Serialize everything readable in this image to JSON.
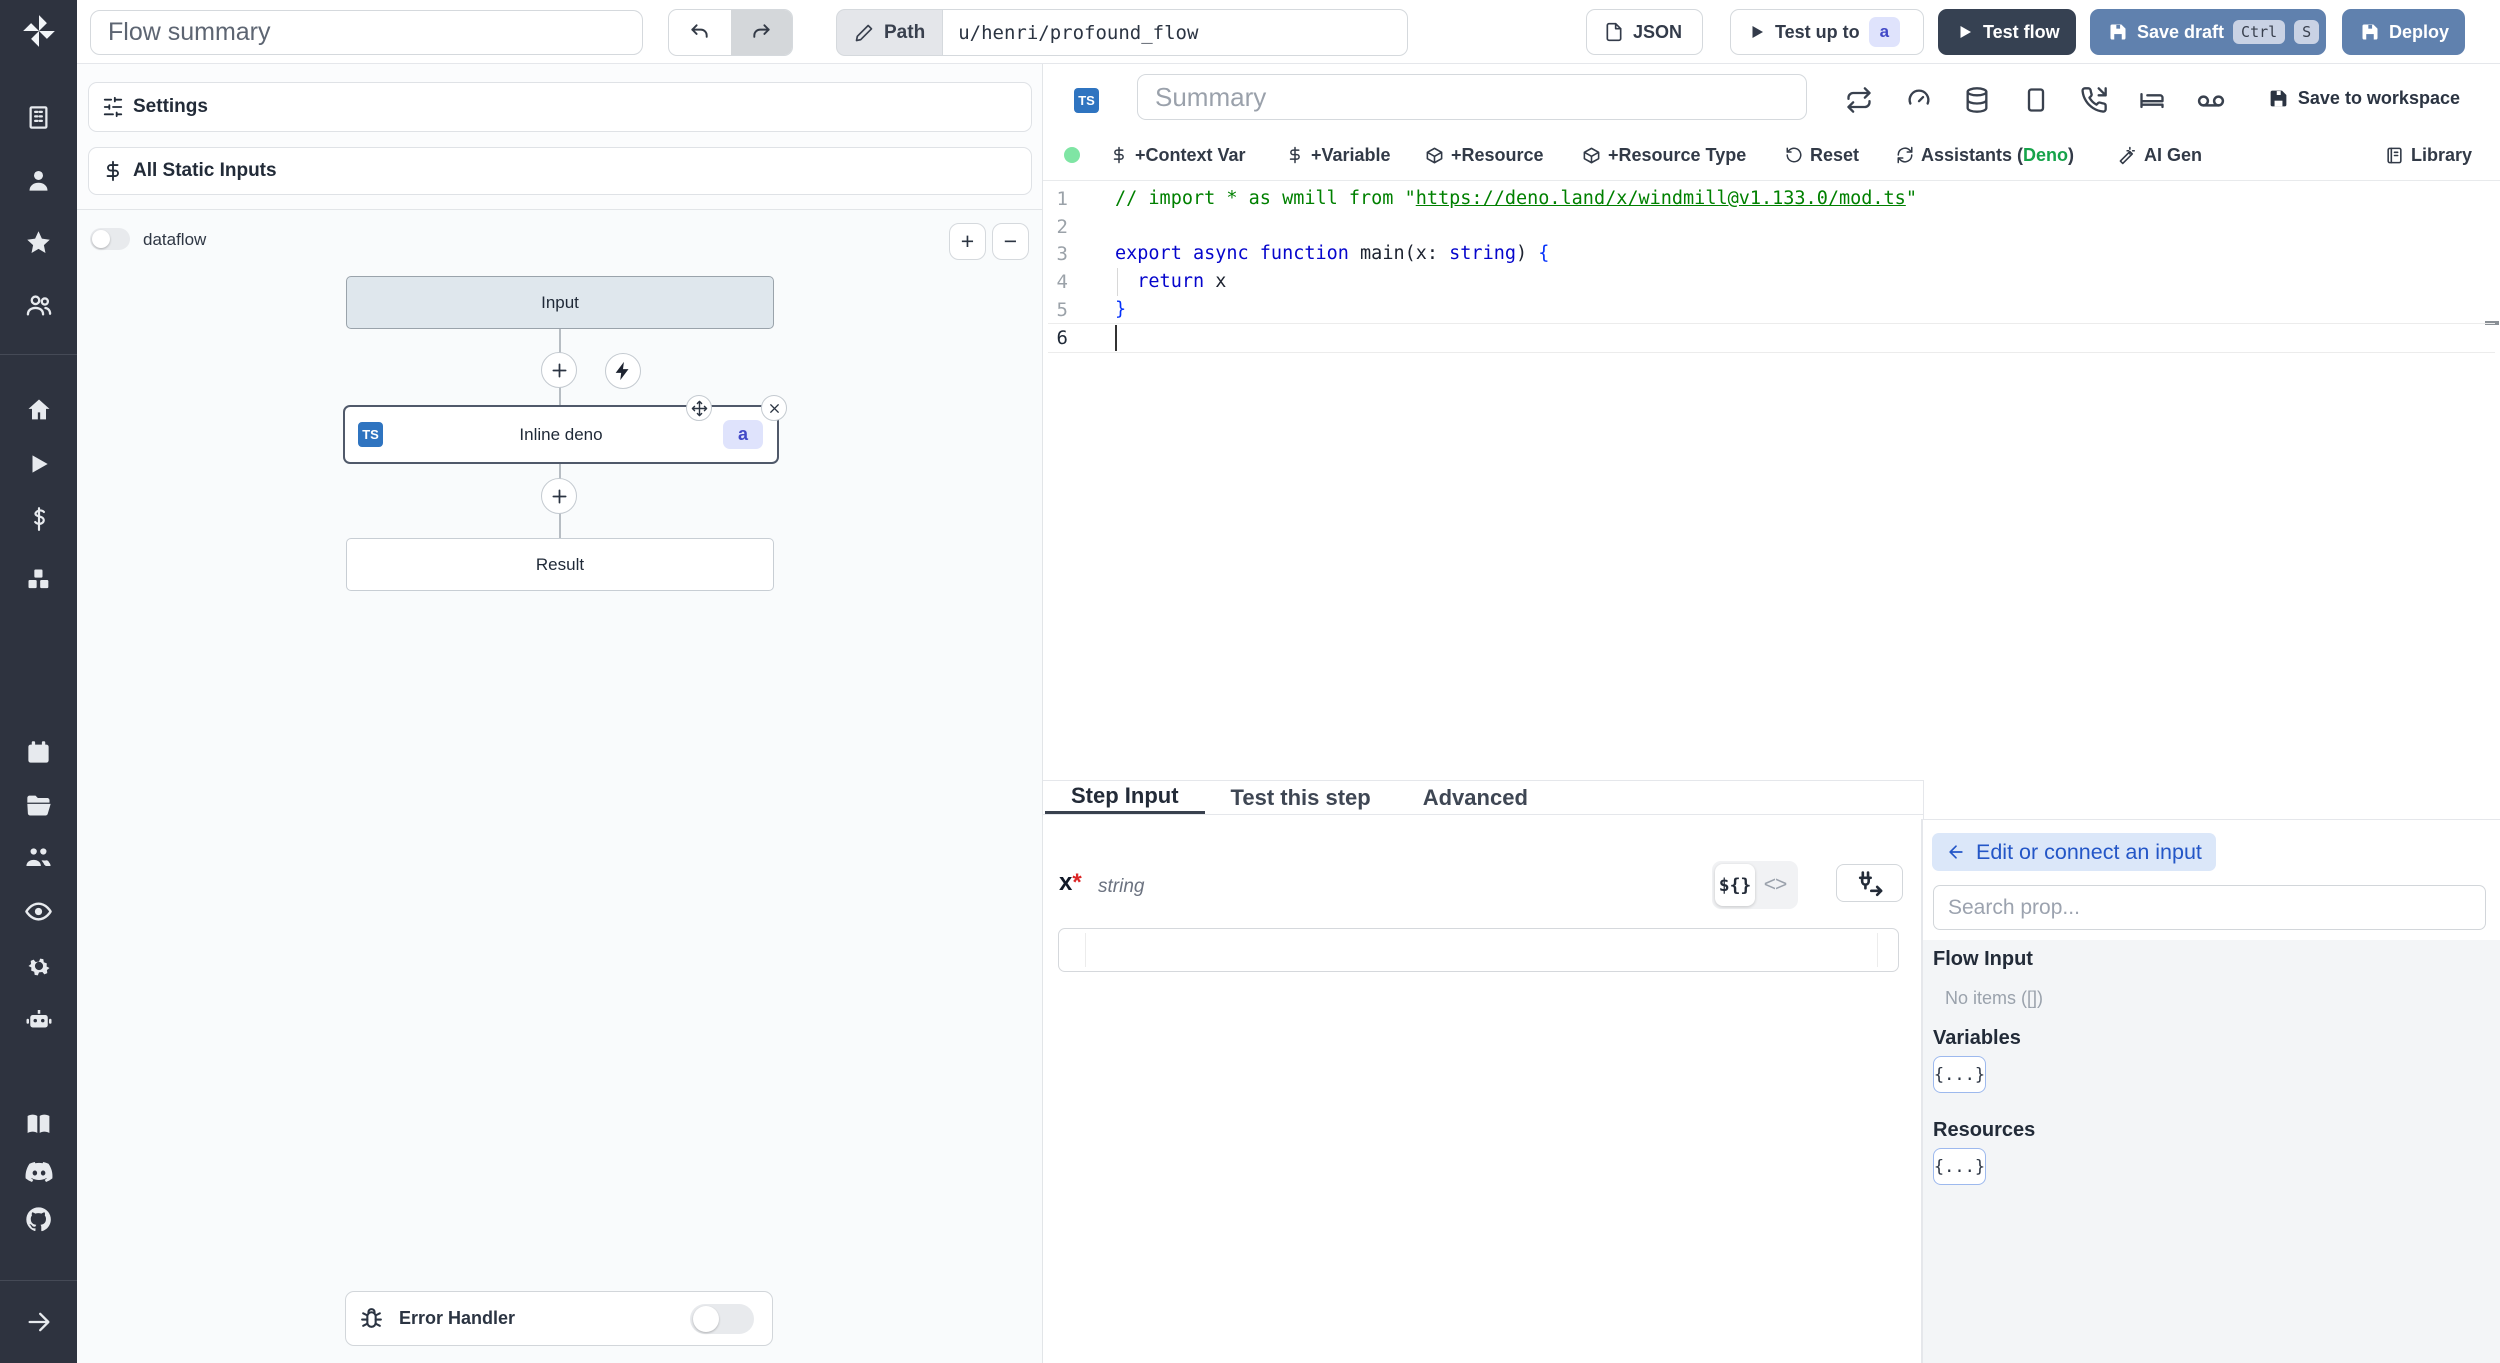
{
  "topbar": {
    "flow_summary": "Flow summary",
    "path_label": "Path",
    "path_value": "u/henri/profound_flow",
    "json_label": "JSON",
    "test_up_to_label": "Test up to",
    "test_up_to_badge": "a",
    "test_flow_label": "Test flow",
    "save_draft_label": "Save draft",
    "kbd_ctrl": "Ctrl",
    "kbd_s": "S",
    "deploy_label": "Deploy"
  },
  "left_panel": {
    "settings_label": "Settings",
    "static_inputs_label": "All Static Inputs",
    "dataflow_label": "dataflow",
    "zoom_in": "+",
    "zoom_out": "−",
    "error_handler_label": "Error Handler"
  },
  "flow": {
    "input_node": "Input",
    "step_node": "Inline deno",
    "step_lang_badge": "TS",
    "step_badge": "a",
    "result_node": "Result"
  },
  "editor": {
    "lang_badge": "TS",
    "summary_placeholder": "Summary",
    "save_to_workspace": "Save to workspace",
    "toolbar": {
      "context_var": "+Context Var",
      "variable": "+Variable",
      "resource": "+Resource",
      "resource_type": "+Resource Type",
      "reset": "Reset",
      "assistants_prefix": "Assistants (",
      "assistants_lang": "Deno",
      "assistants_suffix": ")",
      "ai_gen": "AI Gen",
      "library": "Library"
    }
  },
  "code": {
    "lines": [
      {
        "num": "1",
        "segments": [
          [
            "c",
            "// import * as wmill from \""
          ],
          [
            "u",
            "https://deno.land/x/windmill@v1.133.0/mod.ts"
          ],
          [
            "c",
            "\""
          ]
        ]
      },
      {
        "num": "2",
        "segments": []
      },
      {
        "num": "3",
        "segments": [
          [
            "k",
            "export async function "
          ],
          [
            "p",
            "main(x: "
          ],
          [
            "k",
            "string"
          ],
          [
            "p",
            ") "
          ],
          [
            "b",
            "{"
          ]
        ]
      },
      {
        "num": "4",
        "segments": [
          [
            "p",
            "  "
          ],
          [
            "k",
            "return"
          ],
          [
            "p",
            " x"
          ]
        ]
      },
      {
        "num": "5",
        "segments": [
          [
            "b",
            "}"
          ]
        ]
      },
      {
        "num": "6",
        "segments": []
      }
    ]
  },
  "bottom": {
    "tabs": [
      "Step Input",
      "Test this step",
      "Advanced"
    ],
    "field_name": "x",
    "field_required": "*",
    "field_type": "string",
    "seg_expr": "${}",
    "seg_code": "<>"
  },
  "connect": {
    "back_button": "Edit or connect an input",
    "search_placeholder": "Search prop...",
    "flow_input_title": "Flow Input",
    "flow_input_empty": "No items ([])",
    "variables_title": "Variables",
    "variables_chip": "{...}",
    "resources_title": "Resources",
    "resources_chip": "{...}"
  }
}
